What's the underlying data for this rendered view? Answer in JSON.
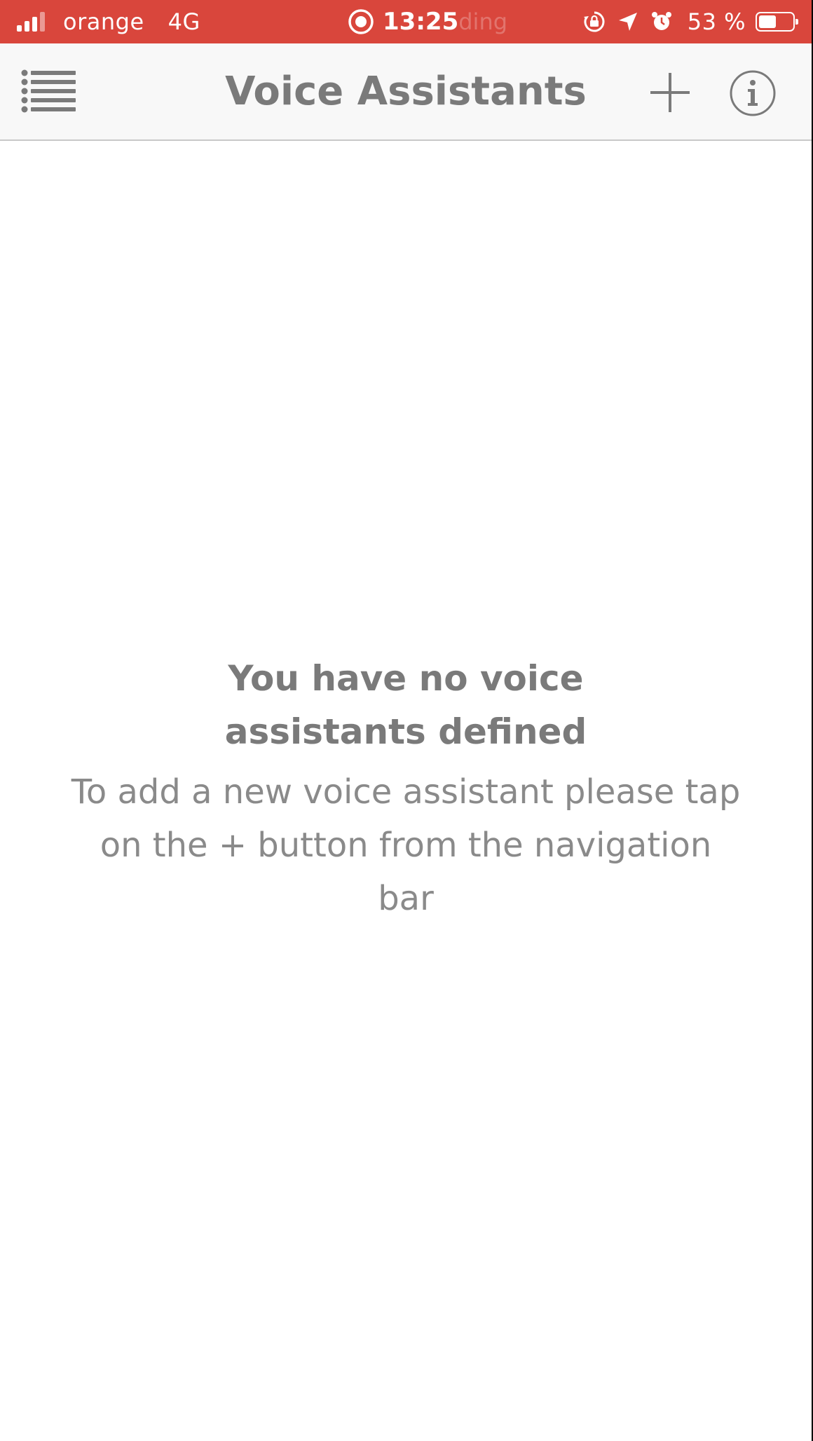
{
  "status_bar": {
    "carrier": "orange",
    "network": "4G",
    "time": "13:25",
    "time_ghost": "ding",
    "battery_percent": "53 %",
    "battery_level": 0.53,
    "signal_bars": 4,
    "signal_bars_active": 3,
    "icons": [
      "record-icon",
      "rotation-lock-icon",
      "location-arrow-icon",
      "alarm-icon",
      "battery-icon"
    ]
  },
  "nav_bar": {
    "title": "Voice Assistants",
    "left_icon": "list-menu-icon",
    "right_icons": [
      "plus-icon",
      "info-icon"
    ]
  },
  "empty_state": {
    "title": "You have no voice assistants defined",
    "message": "To add a new voice assistant please tap on the + button from the navigation bar"
  },
  "colors": {
    "status_bar_bg": "#d9463c",
    "nav_bar_bg": "#f8f8f8",
    "text_gray": "#7a7a7a",
    "background": "#ffffff"
  }
}
